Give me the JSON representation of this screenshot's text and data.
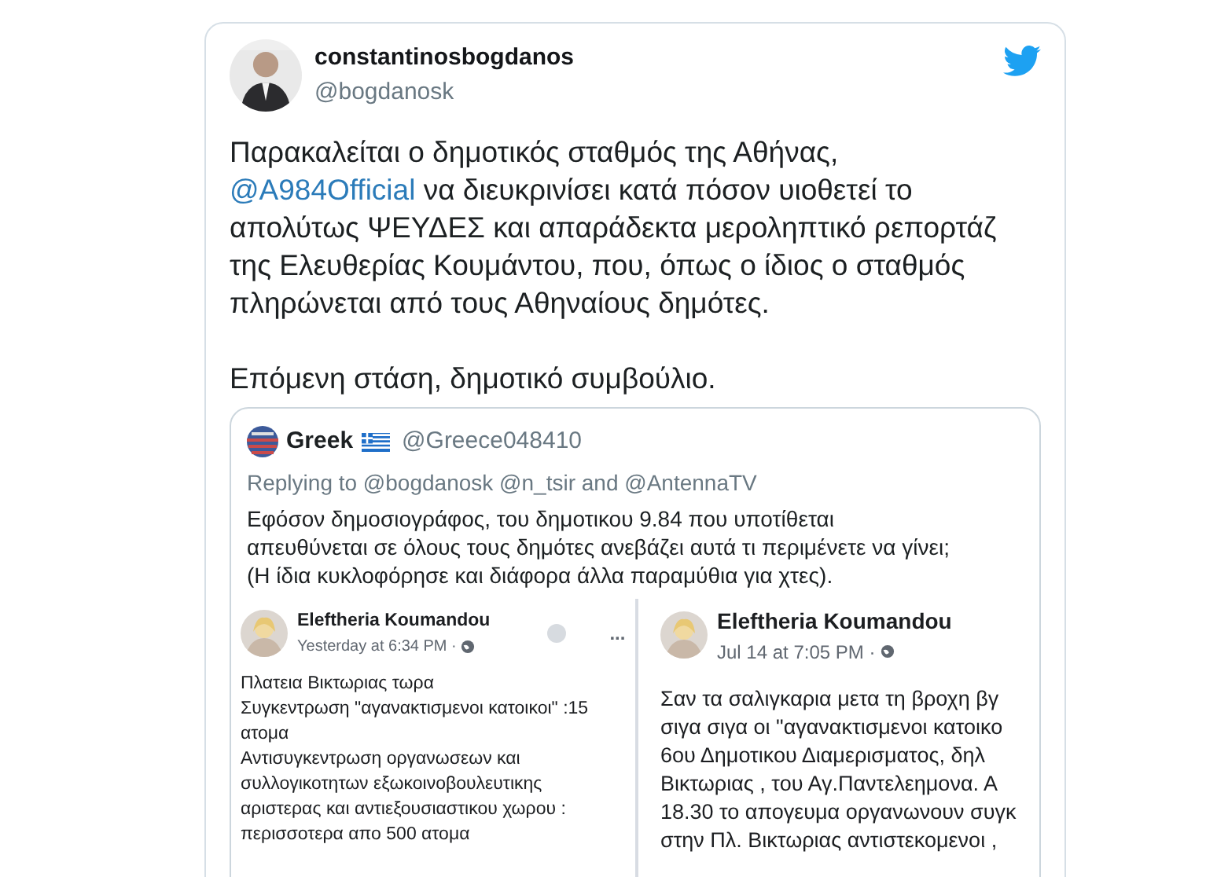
{
  "tweet": {
    "author": {
      "name": "constantinosbogdanos",
      "handle": "@bogdanosk"
    },
    "paragraphs": [
      {
        "parts": [
          {
            "kind": "text",
            "text": "Παρακαλείται ο δημοτικός σταθμός της Αθήνας, "
          },
          {
            "kind": "mention",
            "text": "@A984Official"
          },
          {
            "kind": "text",
            "text": " να διευκρινίσει κατά πόσον υιοθετεί το απολύτως ΨΕΥΔΕΣ και απαράδεκτα μεροληπτικό ρεπορτάζ της Ελευθερίας Κουμάντου, που, όπως ο ίδιος ο σταθμός πληρώνεται από τους Αθηναίους δημότες."
          }
        ]
      },
      {
        "parts": [
          {
            "kind": "text",
            "text": "Επόμενη στάση, δημοτικό συμβούλιο."
          }
        ]
      }
    ],
    "quote": {
      "author": {
        "name": "Greek",
        "handle": "@Greece048410"
      },
      "replying_to": "Replying to @bogdanosk @n_tsir and @AntennaTV",
      "text": "Εφόσον δημοσιογράφος, του δημοτικου 9.84 που υποτίθεται απευθύνεται σε όλους τους δημότες ανεβάζει αυτά τι περιμένετε να γίνει; (Η ίδια κυκλοφόρησε και διάφορα άλλα παραμύθια για χτες).",
      "posts": [
        {
          "author": "Eleftheria Koumandou",
          "time": "Yesterday at 6:34 PM ·",
          "more": "...",
          "lines": [
            "Πλατεια Βικτωριας τωρα",
            "Συγκεντρωση \"αγανακτισμενοι κατοικοι\" :15",
            "ατομα",
            "Αντισυγκεντρωση οργανωσεων και",
            "συλλογικοτητων εξωκοινοβουλευτικης",
            "αριστερας και αντιεξουσιαστικου χωρου :",
            "περισσοτερα απο 500 ατομα"
          ]
        },
        {
          "author": "Eleftheria Koumandou",
          "time": "Jul 14 at 7:05 PM ·",
          "lines": [
            "Σαν τα σαλιγκαρια μετα τη βροχη βγ",
            "σιγα σιγα οι \"αγανακτισμενοι κατοικο",
            "6ου Δημοτικου Διαμερισματος, δηλ",
            "Βικτωριας , του Αγ.Παντελεημονα. Α",
            "18.30 το απογευμα οργανωνουν συγκ",
            "στην Πλ. Βικτωριας αντιστεκομενοι ,"
          ]
        }
      ]
    }
  }
}
